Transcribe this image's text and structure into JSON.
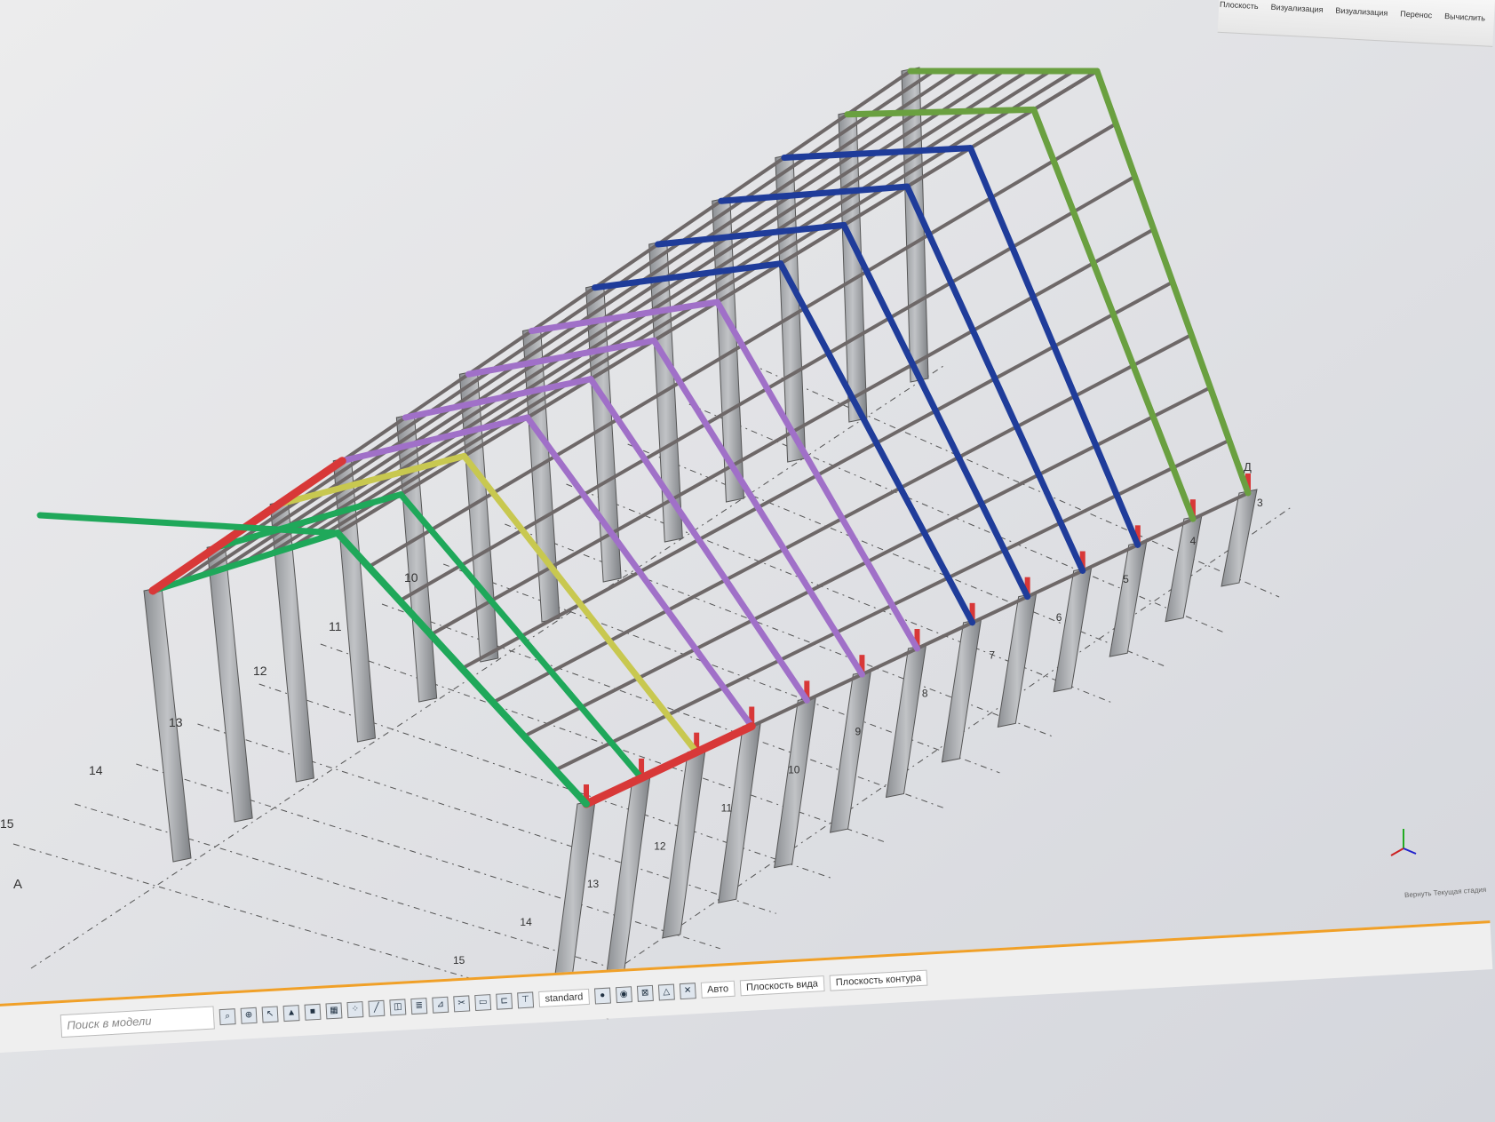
{
  "app": {
    "name": "3D structural model viewer"
  },
  "ribbon": {
    "items": [
      "Плоскость",
      "Визуализация",
      "Визуализация",
      "Перенос",
      "Вычислить"
    ]
  },
  "toolbar": {
    "search_placeholder": "Поиск в модели",
    "view_style": "standard",
    "mode": "Авто",
    "plane_view": "Плоскость вида",
    "plane_contour": "Плоскость контура"
  },
  "status": {
    "text": "Вернуть Текущая стадия"
  },
  "grid": {
    "axis_letter_near": "А",
    "axis_letter_far": "Д",
    "numbers_left": [
      "10",
      "11",
      "12",
      "13",
      "14",
      "15"
    ],
    "numbers_right": [
      "3",
      "4",
      "5",
      "6",
      "7",
      "8",
      "9",
      "10",
      "11",
      "12",
      "13",
      "14",
      "15"
    ]
  },
  "colors": {
    "column": "#a9abae",
    "purlin": "#6e6868",
    "frame_green": "#1fa85a",
    "brace_blue": "#1f3c9a",
    "brace_purple": "#a070c8",
    "brace_yellow": "#c8c850",
    "eave_red": "#d83838",
    "ridge_green": "#6aa040",
    "accent_orange": "#f0a028"
  }
}
